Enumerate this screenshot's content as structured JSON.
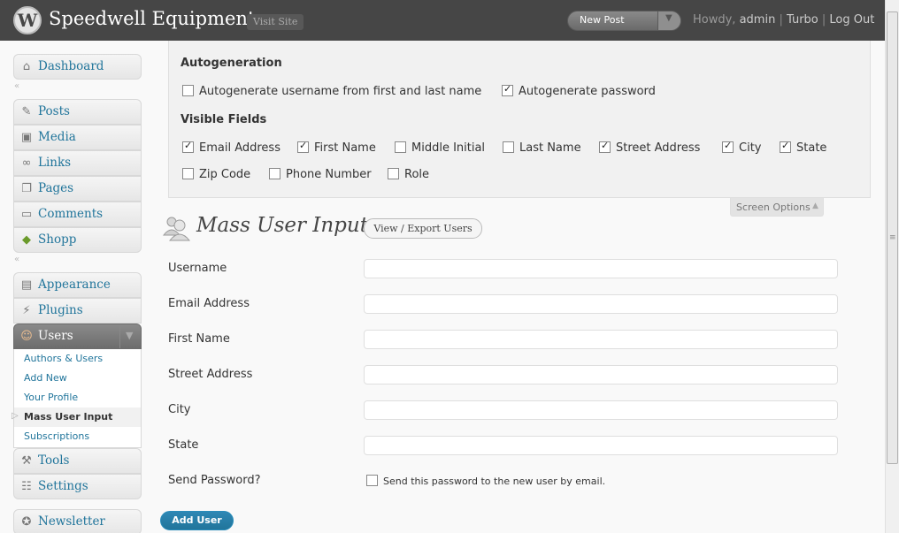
{
  "header": {
    "site_title": "Speedwell Equipment",
    "visit_site": "Visit Site",
    "favorite_action": "New Post",
    "howdy": "Howdy, ",
    "username": "admin",
    "turbo": "Turbo",
    "logout": "Log Out",
    "separator": "|"
  },
  "menu": {
    "dashboard": "Dashboard",
    "posts": "Posts",
    "media": "Media",
    "links": "Links",
    "pages": "Pages",
    "comments": "Comments",
    "shopp": "Shopp",
    "appearance": "Appearance",
    "plugins": "Plugins",
    "users": "Users",
    "users_submenu": [
      "Authors & Users",
      "Add New",
      "Your Profile",
      "Mass User Input",
      "Subscriptions"
    ],
    "tools": "Tools",
    "settings": "Settings",
    "newsletter": "Newsletter"
  },
  "screen_options": {
    "autogen_heading": "Autogeneration",
    "autogen_username": {
      "label": "Autogenerate username from first and last name",
      "checked": false
    },
    "autogen_password": {
      "label": "Autogenerate password",
      "checked": true
    },
    "visible_heading": "Visible Fields",
    "fields": [
      {
        "label": "Email Address",
        "checked": true
      },
      {
        "label": "First Name",
        "checked": true
      },
      {
        "label": "Middle Initial",
        "checked": false
      },
      {
        "label": "Last Name",
        "checked": false
      },
      {
        "label": "Street Address",
        "checked": true
      },
      {
        "label": "City",
        "checked": true
      },
      {
        "label": "State",
        "checked": true
      },
      {
        "label": "Zip Code",
        "checked": false
      },
      {
        "label": "Phone Number",
        "checked": false
      },
      {
        "label": "Role",
        "checked": false
      }
    ],
    "tab_label": "Screen Options"
  },
  "page": {
    "title": "Mass User Input",
    "view_export": "View / Export Users"
  },
  "form": {
    "username": "Username",
    "email": "Email Address",
    "first_name": "First Name",
    "street": "Street Address",
    "city": "City",
    "state": "State",
    "send_password": "Send Password?",
    "send_password_check": "Send this password to the new user by email.",
    "submit": "Add User"
  }
}
